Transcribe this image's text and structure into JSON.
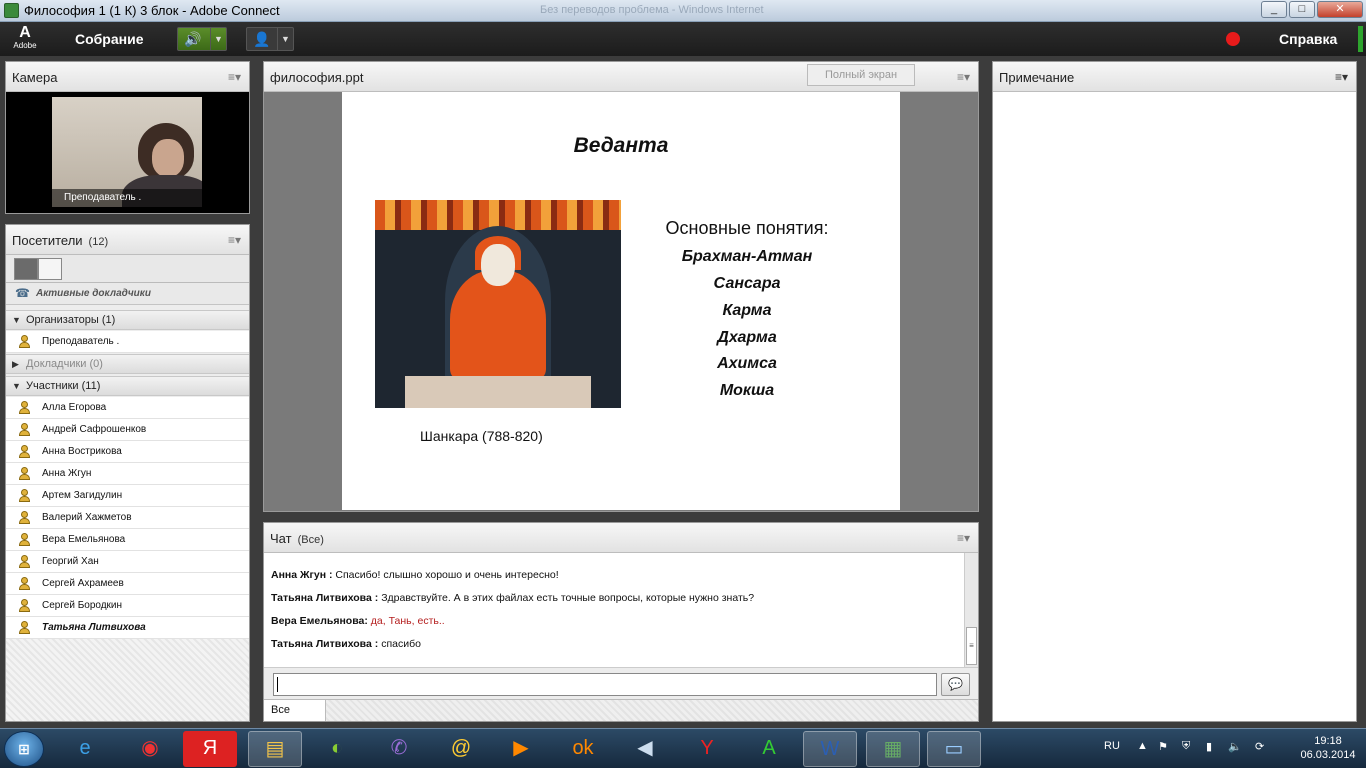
{
  "window": {
    "title": "Философия 1 (1 К) 3 блок - Adobe Connect",
    "background_title": "Без переводов проблема - Windows Internet",
    "min": "_",
    "max": "□",
    "close": "✕"
  },
  "menubar": {
    "logo_glyph": "A",
    "logo_text": "Adobe",
    "meeting_label": "Собрание",
    "help_label": "Справка",
    "speaker_icon": "speaker-icon",
    "camera_icon": "camera-user-icon"
  },
  "camera_pod": {
    "title": "Камера",
    "video_label": "Преподаватель ."
  },
  "attendees_pod": {
    "title": "Посетители",
    "count": "(12)",
    "active_speakers": "Активные докладчики",
    "hosts": {
      "label": "Организаторы (1)",
      "members": [
        "Преподаватель ."
      ]
    },
    "presenters": {
      "label": "Докладчики (0)"
    },
    "participants": {
      "label": "Участники (11)",
      "members": [
        "Алла Егорова",
        "Андрей Сафрошенков",
        "Анна Вострикова",
        "Анна Жгун",
        "Артем Загидулин",
        "Валерий Хажметов",
        "Вера Емельянова",
        "Георгий Хан",
        "Сергей Ахрамеев",
        "Сергей Бородкин",
        "Татьяна Литвихова"
      ]
    }
  },
  "share_pod": {
    "title": "философия.ppt",
    "fullscreen_label": "Полный экран",
    "slide": {
      "title": "Веданта",
      "caption": "Шанкара (788-820)",
      "concepts_heading": "Основные понятия:",
      "concepts": [
        "Брахман-Атман",
        "Сансара",
        "Карма",
        "Дхарма",
        "Ахимса",
        "Мокша"
      ]
    }
  },
  "chat_pod": {
    "title": "Чат",
    "scope": "(Все)",
    "messages": [
      {
        "author": "Анна Жгун :",
        "text": "Спасибо! слышно хорошо и очень интересно!"
      },
      {
        "author": "Татьяна Литвихова :",
        "text": "Здравствуйте. А в этих файлах есть точные вопросы, которые нужно знать?"
      },
      {
        "author": "Вера Емельянова:",
        "text": "да, Тань, есть.."
      },
      {
        "author": "Татьяна Литвихова :",
        "text": "спасибо"
      }
    ],
    "tab_label": "Все",
    "accent_red": "#b41e1e"
  },
  "note_pod": {
    "title": "Примечание"
  },
  "taskbar": {
    "language": "RU",
    "time": "19:18",
    "date": "06.03.2014",
    "apps": [
      "ie-icon",
      "chrome-icon",
      "yandex-icon",
      "explorer-icon",
      "app-icon",
      "viber-icon",
      "mail-icon",
      "video-icon",
      "ok-icon",
      "audio-icon",
      "yandex-browser-icon",
      "a-icon",
      "word-icon",
      "connect-icon",
      "monitor-icon"
    ]
  }
}
